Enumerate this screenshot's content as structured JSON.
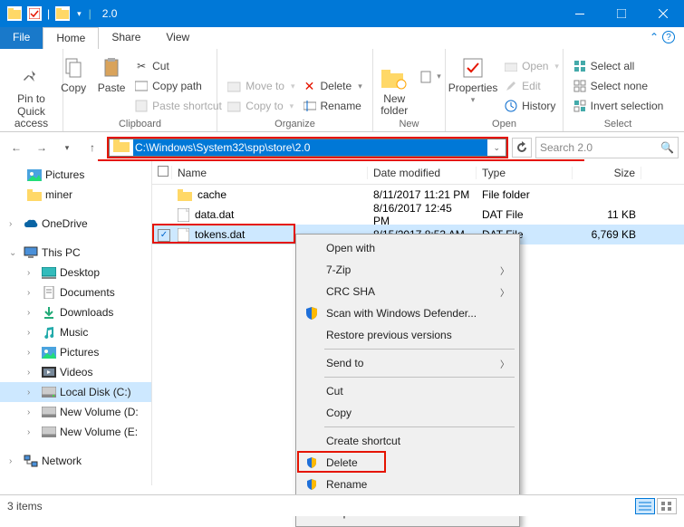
{
  "window": {
    "title": "2.0"
  },
  "tabs": {
    "file": "File",
    "home": "Home",
    "share": "Share",
    "view": "View"
  },
  "ribbon": {
    "pin": "Pin to Quick access",
    "copy": "Copy",
    "paste": "Paste",
    "cut": "Cut",
    "copypath": "Copy path",
    "pasteshortcut": "Paste shortcut",
    "clipboard": "Clipboard",
    "moveto": "Move to",
    "copyto": "Copy to",
    "delete": "Delete",
    "rename": "Rename",
    "organize": "Organize",
    "newfolder": "New folder",
    "new": "New",
    "properties": "Properties",
    "openlbl": "Open",
    "edit": "Edit",
    "history": "History",
    "open": "Open",
    "selectall": "Select all",
    "selectnone": "Select none",
    "invert": "Invert selection",
    "select": "Select"
  },
  "address": {
    "path": "C:\\Windows\\System32\\spp\\store\\2.0"
  },
  "search": {
    "placeholder": "Search 2.0"
  },
  "nav": {
    "pictures": "Pictures",
    "miner": "miner",
    "onedrive": "OneDrive",
    "thispc": "This PC",
    "desktop": "Desktop",
    "documents": "Documents",
    "downloads": "Downloads",
    "music": "Music",
    "picsub": "Pictures",
    "videos": "Videos",
    "localc": "Local Disk (C:)",
    "newvold": "New Volume (D:",
    "newvole": "New Volume (E:",
    "network": "Network"
  },
  "cols": {
    "name": "Name",
    "date": "Date modified",
    "type": "Type",
    "size": "Size"
  },
  "files": [
    {
      "name": "cache",
      "date": "8/11/2017 11:21 PM",
      "type": "File folder",
      "size": "",
      "kind": "folder"
    },
    {
      "name": "data.dat",
      "date": "8/16/2017 12:45 PM",
      "type": "DAT File",
      "size": "11 KB",
      "kind": "file"
    },
    {
      "name": "tokens.dat",
      "date": "8/15/2017 8:53 AM",
      "type": "DAT File",
      "size": "6,769 KB",
      "kind": "file"
    }
  ],
  "context": {
    "openwith": "Open with",
    "sevenzip": "7-Zip",
    "crcsha": "CRC SHA",
    "scan": "Scan with Windows Defender...",
    "restore": "Restore previous versions",
    "sendto": "Send to",
    "cut": "Cut",
    "copy": "Copy",
    "shortcut": "Create shortcut",
    "delete": "Delete",
    "rename": "Rename",
    "properties": "Properties"
  },
  "status": {
    "count": "3 items"
  }
}
